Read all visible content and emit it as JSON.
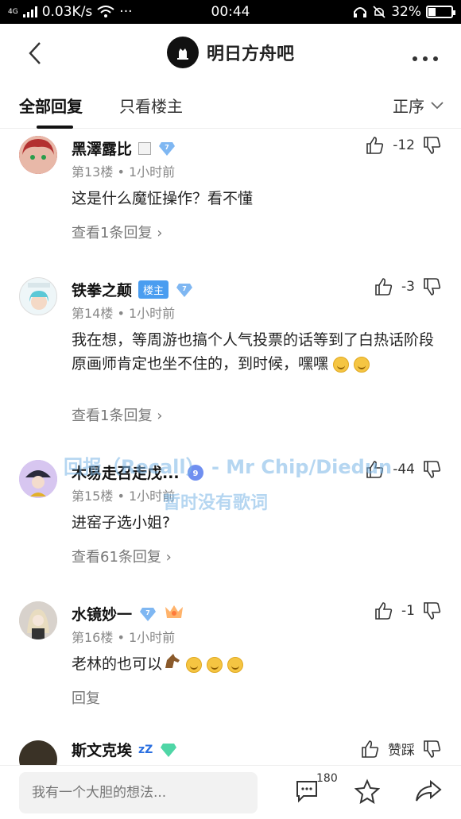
{
  "status": {
    "network_type": "4G",
    "speed": "0.03K/s",
    "dots": "···",
    "time": "00:44",
    "battery": "32%",
    "battery_level": 0.32
  },
  "nav": {
    "title": "明日方舟吧"
  },
  "tabs": {
    "all": "全部回复",
    "host_only": "只看楼主",
    "sort": "正序"
  },
  "posts": [
    {
      "username": "黑澤露比",
      "level": "7",
      "meta": "第13楼 • 1小时前",
      "body": "这是什么魔怔操作？看不懂",
      "replies": "查看1条回复",
      "score": "-12"
    },
    {
      "username": "铁拳之颠",
      "host_tag": "楼主",
      "level": "7",
      "meta": "第14楼 • 1小时前",
      "body": "我在想，等周游也搞个人气投票的话等到了白热话阶段原画师肯定也坐不住的，到时候，嘿嘿",
      "replies": "查看1条回复",
      "score": "-3"
    },
    {
      "username": "木易走召走戊...",
      "level": "9",
      "meta": "第15楼 • 1小时前",
      "body": "进窑子选小姐?",
      "replies": "查看61条回复",
      "score": "-44"
    },
    {
      "username": "水镜妙一",
      "level": "7",
      "meta": "第16楼 • 1小时前",
      "body": "老林的也可以",
      "replies": "回复",
      "score": "-1"
    },
    {
      "username": "斯文克埃",
      "zz": "zZ",
      "level": "",
      "score": "赞踩"
    }
  ],
  "watermark": {
    "line1": "回报（Recall） - Mr Chip/Diedun",
    "line2": "暂时没有歌词"
  },
  "bottom": {
    "placeholder": "我有一个大胆的想法...",
    "comment_count": "180"
  },
  "colors": {
    "accent": "#4a9df0",
    "level_blue": "#7fb7f2",
    "level_green": "#4fd6a6"
  }
}
